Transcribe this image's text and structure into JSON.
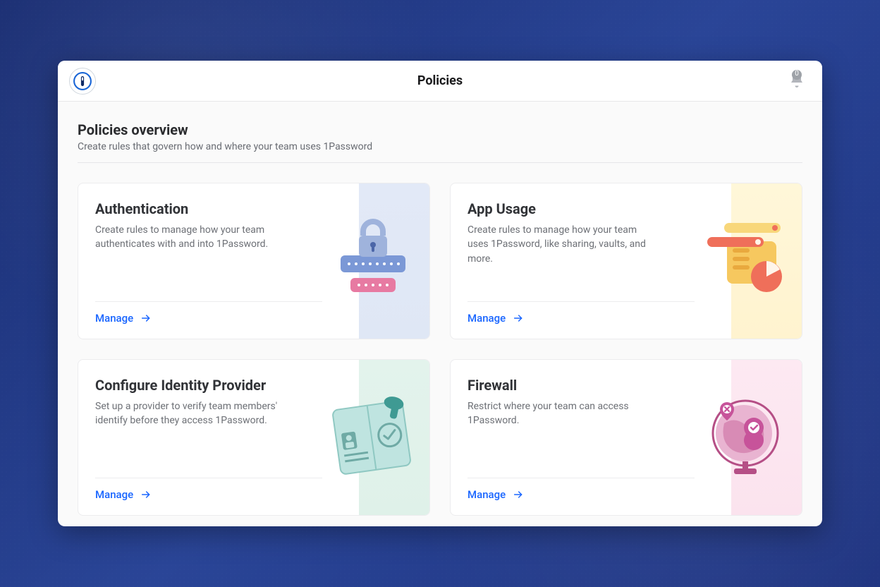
{
  "header": {
    "title": "Policies",
    "notification_count": "0"
  },
  "overview": {
    "title": "Policies overview",
    "subtitle": "Create rules that govern how and where your team uses 1Password"
  },
  "cards": [
    {
      "title": "Authentication",
      "description": "Create rules to manage how your team authenticates with and into 1Password.",
      "action_label": "Manage"
    },
    {
      "title": "App Usage",
      "description": "Create rules to manage how your team uses 1Password, like sharing, vaults, and more.",
      "action_label": "Manage"
    },
    {
      "title": "Configure Identity Provider",
      "description": "Set up a provider to verify team members' identify before they access 1Password.",
      "action_label": "Manage"
    },
    {
      "title": "Firewall",
      "description": "Restrict where your team can access 1Password.",
      "action_label": "Manage"
    }
  ],
  "colors": {
    "link": "#1a66ff",
    "text_primary": "#2b2c2f",
    "text_secondary": "#696c73"
  }
}
